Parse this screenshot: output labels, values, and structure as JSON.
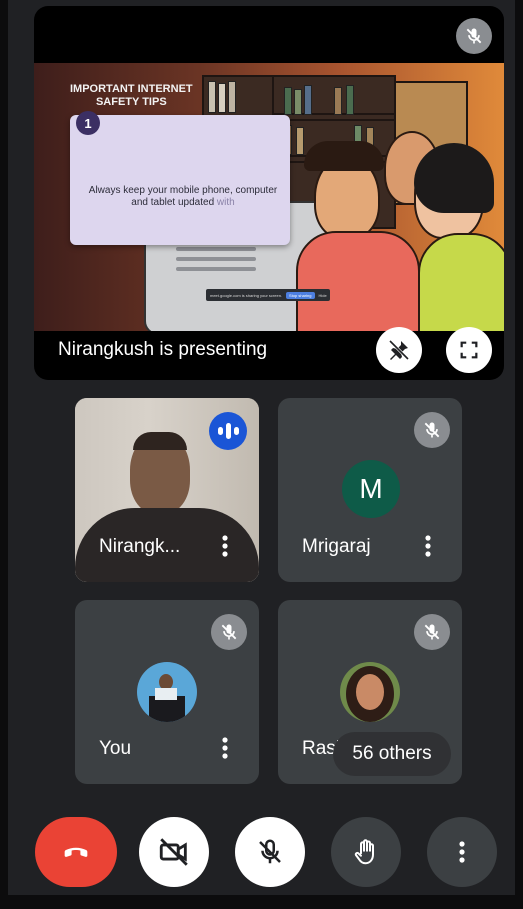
{
  "presentation": {
    "presenter_label": "Nirangkush is presenting",
    "slide": {
      "title_line1": "IMPORTANT INTERNET",
      "title_line2": "SAFETY TIPS",
      "tip_number": "1",
      "tip_text": "Always keep your mobile phone, computer and tablet updated",
      "tip_faded_word": "with",
      "share_bar_text": "meet.google.com is sharing your screen.",
      "share_bar_stop": "Stop sharing",
      "share_bar_hide": "Hide"
    }
  },
  "tiles": [
    {
      "name": "Nirangk...",
      "state": "speaking"
    },
    {
      "name": "Mrigaraj",
      "avatar_letter": "M",
      "state": "muted"
    },
    {
      "name": "You",
      "state": "muted"
    },
    {
      "name": "Rash",
      "state": "muted"
    }
  ],
  "others_label": "56 others",
  "colors": {
    "background": "#202124",
    "tile": "#3c4043",
    "end_call": "#ea4335",
    "speaking_badge": "#1a55d6",
    "avatar_m": "#0e5b48"
  },
  "icons": [
    "mic-off-icon",
    "unpin-icon",
    "fullscreen-icon",
    "speaking-icon",
    "more-vert-icon",
    "end-call-icon",
    "camera-off-icon",
    "raise-hand-icon"
  ]
}
